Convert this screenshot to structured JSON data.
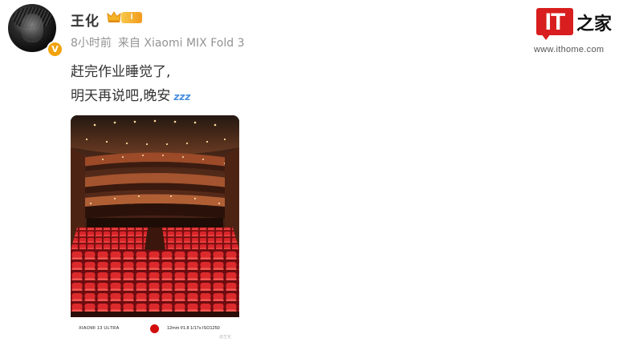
{
  "post": {
    "author": {
      "name": "王化",
      "level_badge": "I",
      "verified_icon_text": "V"
    },
    "meta": {
      "time": "8小时前",
      "source": "来自 Xiaomi MIX Fold 3"
    },
    "text_lines": [
      "赶完作业睡觉了,",
      "明天再说吧,晚安"
    ],
    "emoji": "zzz",
    "photo": {
      "camera_model": "XIAOMI 13 ULTRA",
      "exif": "12mm  f/1.8  1/17s  ISO1250",
      "watermark": "@王化"
    }
  },
  "watermark_logo": {
    "brand_text": "IT",
    "brand_char": "之家",
    "url": "www.ithome.com"
  },
  "colors": {
    "name": "#333333",
    "meta": "#939393",
    "seat_red": "#d8262a",
    "level_gold": "#f39a1b",
    "logo_red": "#d81e1e"
  }
}
